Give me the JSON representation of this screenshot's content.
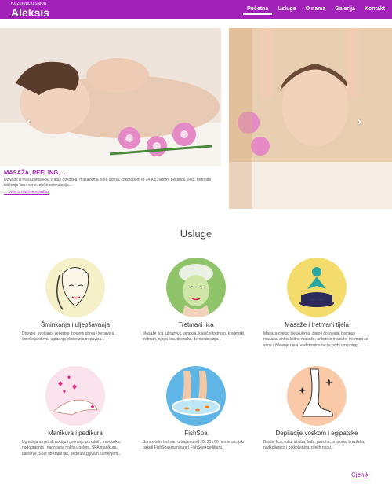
{
  "header": {
    "subtitle": "Kozmetički salon",
    "title": "Aleksis",
    "nav": [
      "Početna",
      "Usluge",
      "O nama",
      "Galerija",
      "Kontakt"
    ],
    "active_nav": "Početna"
  },
  "slider": {
    "caption_title": "MASAŽA, PEELING, ...",
    "caption_text": "Uživajte u masažama lica, vrata i dekoltea, masažama tijela uljima, čokoladom te 24 Ka zlatom, peelingu tijela, tretmani čišćenja lica i vene, elektrostimulacija...",
    "caption_link": "... više u našem cjeniku",
    "prev_arrow": "‹",
    "next_arrow": "›"
  },
  "services": {
    "section_title": "Usluge",
    "items": [
      {
        "title": "Šminkanja i uljepšavanja",
        "desc": "Dnevno, svečano, večernje, bojanje obrva i trepavica, korekcija obrva, ugradnja ekstenzija trepavica...",
        "icon": "face-makeup-icon",
        "bg": "#f6f0c8"
      },
      {
        "title": "Tretmani lica",
        "desc": "Masaže lica, ultrazvuk, ampula, klasični tretman, kraljevski tretman, njega lica, drenaža, dermoabrazija...",
        "icon": "face-mask-icon",
        "bg": "#8fc46a"
      },
      {
        "title": "Masaže i tretmani tijela",
        "desc": "Masaža cijelog tijela uljima, zlato i čokolada, bambus masaža, anticelulitne masaže, antistres masaže, tretmani za vene i čišćenje tijela, elektrostimulacija,body wrapping...",
        "icon": "massage-icon",
        "bg": "#f3dc6c"
      },
      {
        "title": "Manikura i pedikura",
        "desc": "Ugradnja umjetnih noktiju i geliranje prirodnih, francuska, nadogradnja i nadopuna noktiju, gelom, SPA manikura, lakiranje, Soaf off-trajni lak, pedikura,gljivom kamenjem...",
        "icon": "nails-icon",
        "bg": "#fbe3ee"
      },
      {
        "title": "FishSpa",
        "desc": "Samostalni tretman u trajanju od 20, 30 i 60 min te akcijski paketi FishSpa+manikura i FishSpa+pedikura.",
        "icon": "fish-spa-icon",
        "bg": "#5fb6e6"
      },
      {
        "title": "Depilacije voskom i egipatske",
        "desc": "Brade, lica, ruku, trbuha, leđa, pazuha, prepona, brazilska, nadkoljenica i potkoljenica, cijelih nogu...",
        "icon": "leg-wax-icon",
        "bg": "#f9c9a8"
      }
    ],
    "footer_link": "Cjenik"
  },
  "colors": {
    "brand": "#a020b8"
  }
}
